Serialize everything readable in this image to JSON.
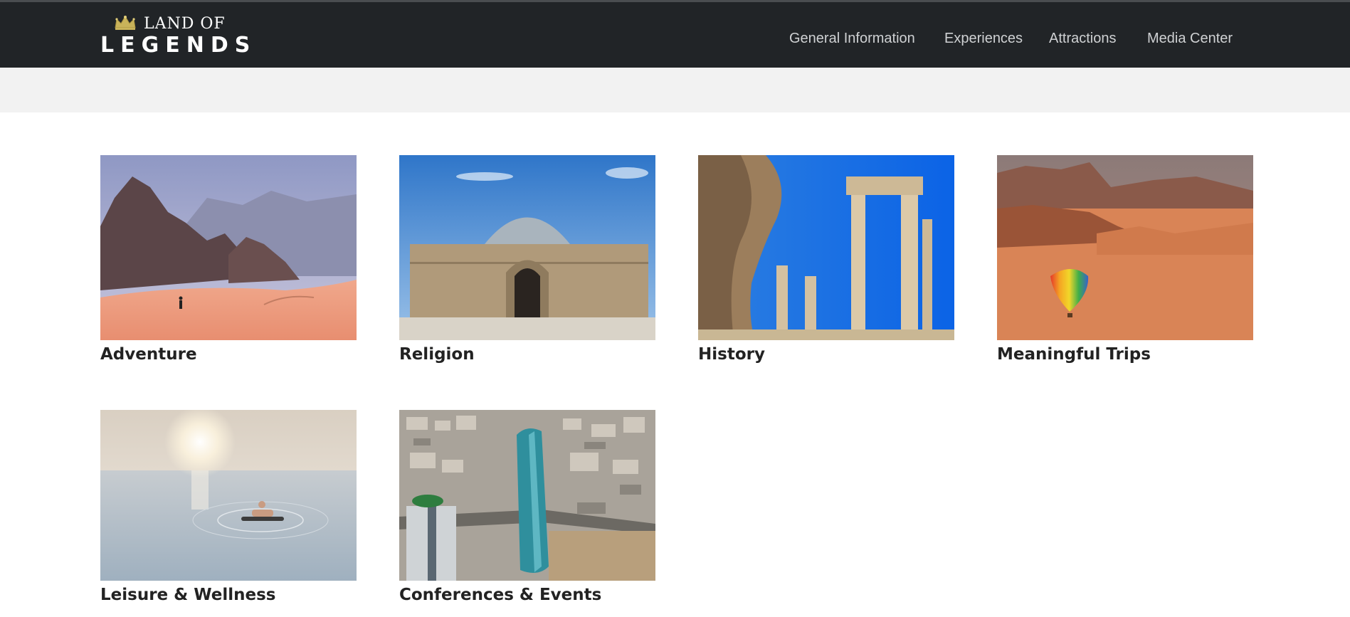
{
  "header": {
    "logo": {
      "line1": "LAND OF",
      "line2": "LEGENDS",
      "crown_color": "#c9b35a"
    },
    "nav": [
      {
        "label": "General Information"
      },
      {
        "label": "Experiences"
      },
      {
        "label": "Attractions"
      },
      {
        "label": "Media Center"
      }
    ],
    "background": "#212427"
  },
  "experiences": [
    {
      "title": "Adventure",
      "image": "desert-hiker-photo"
    },
    {
      "title": "Religion",
      "image": "umayyad-palace-photo"
    },
    {
      "title": "History",
      "image": "temple-of-hercules-photo"
    },
    {
      "title": "Meaningful Trips",
      "image": "hot-air-balloon-desert-photo"
    },
    {
      "title": "Leisure & Wellness",
      "image": "dead-sea-float-photo"
    },
    {
      "title": "Conferences & Events",
      "image": "amman-skyline-photo"
    }
  ]
}
